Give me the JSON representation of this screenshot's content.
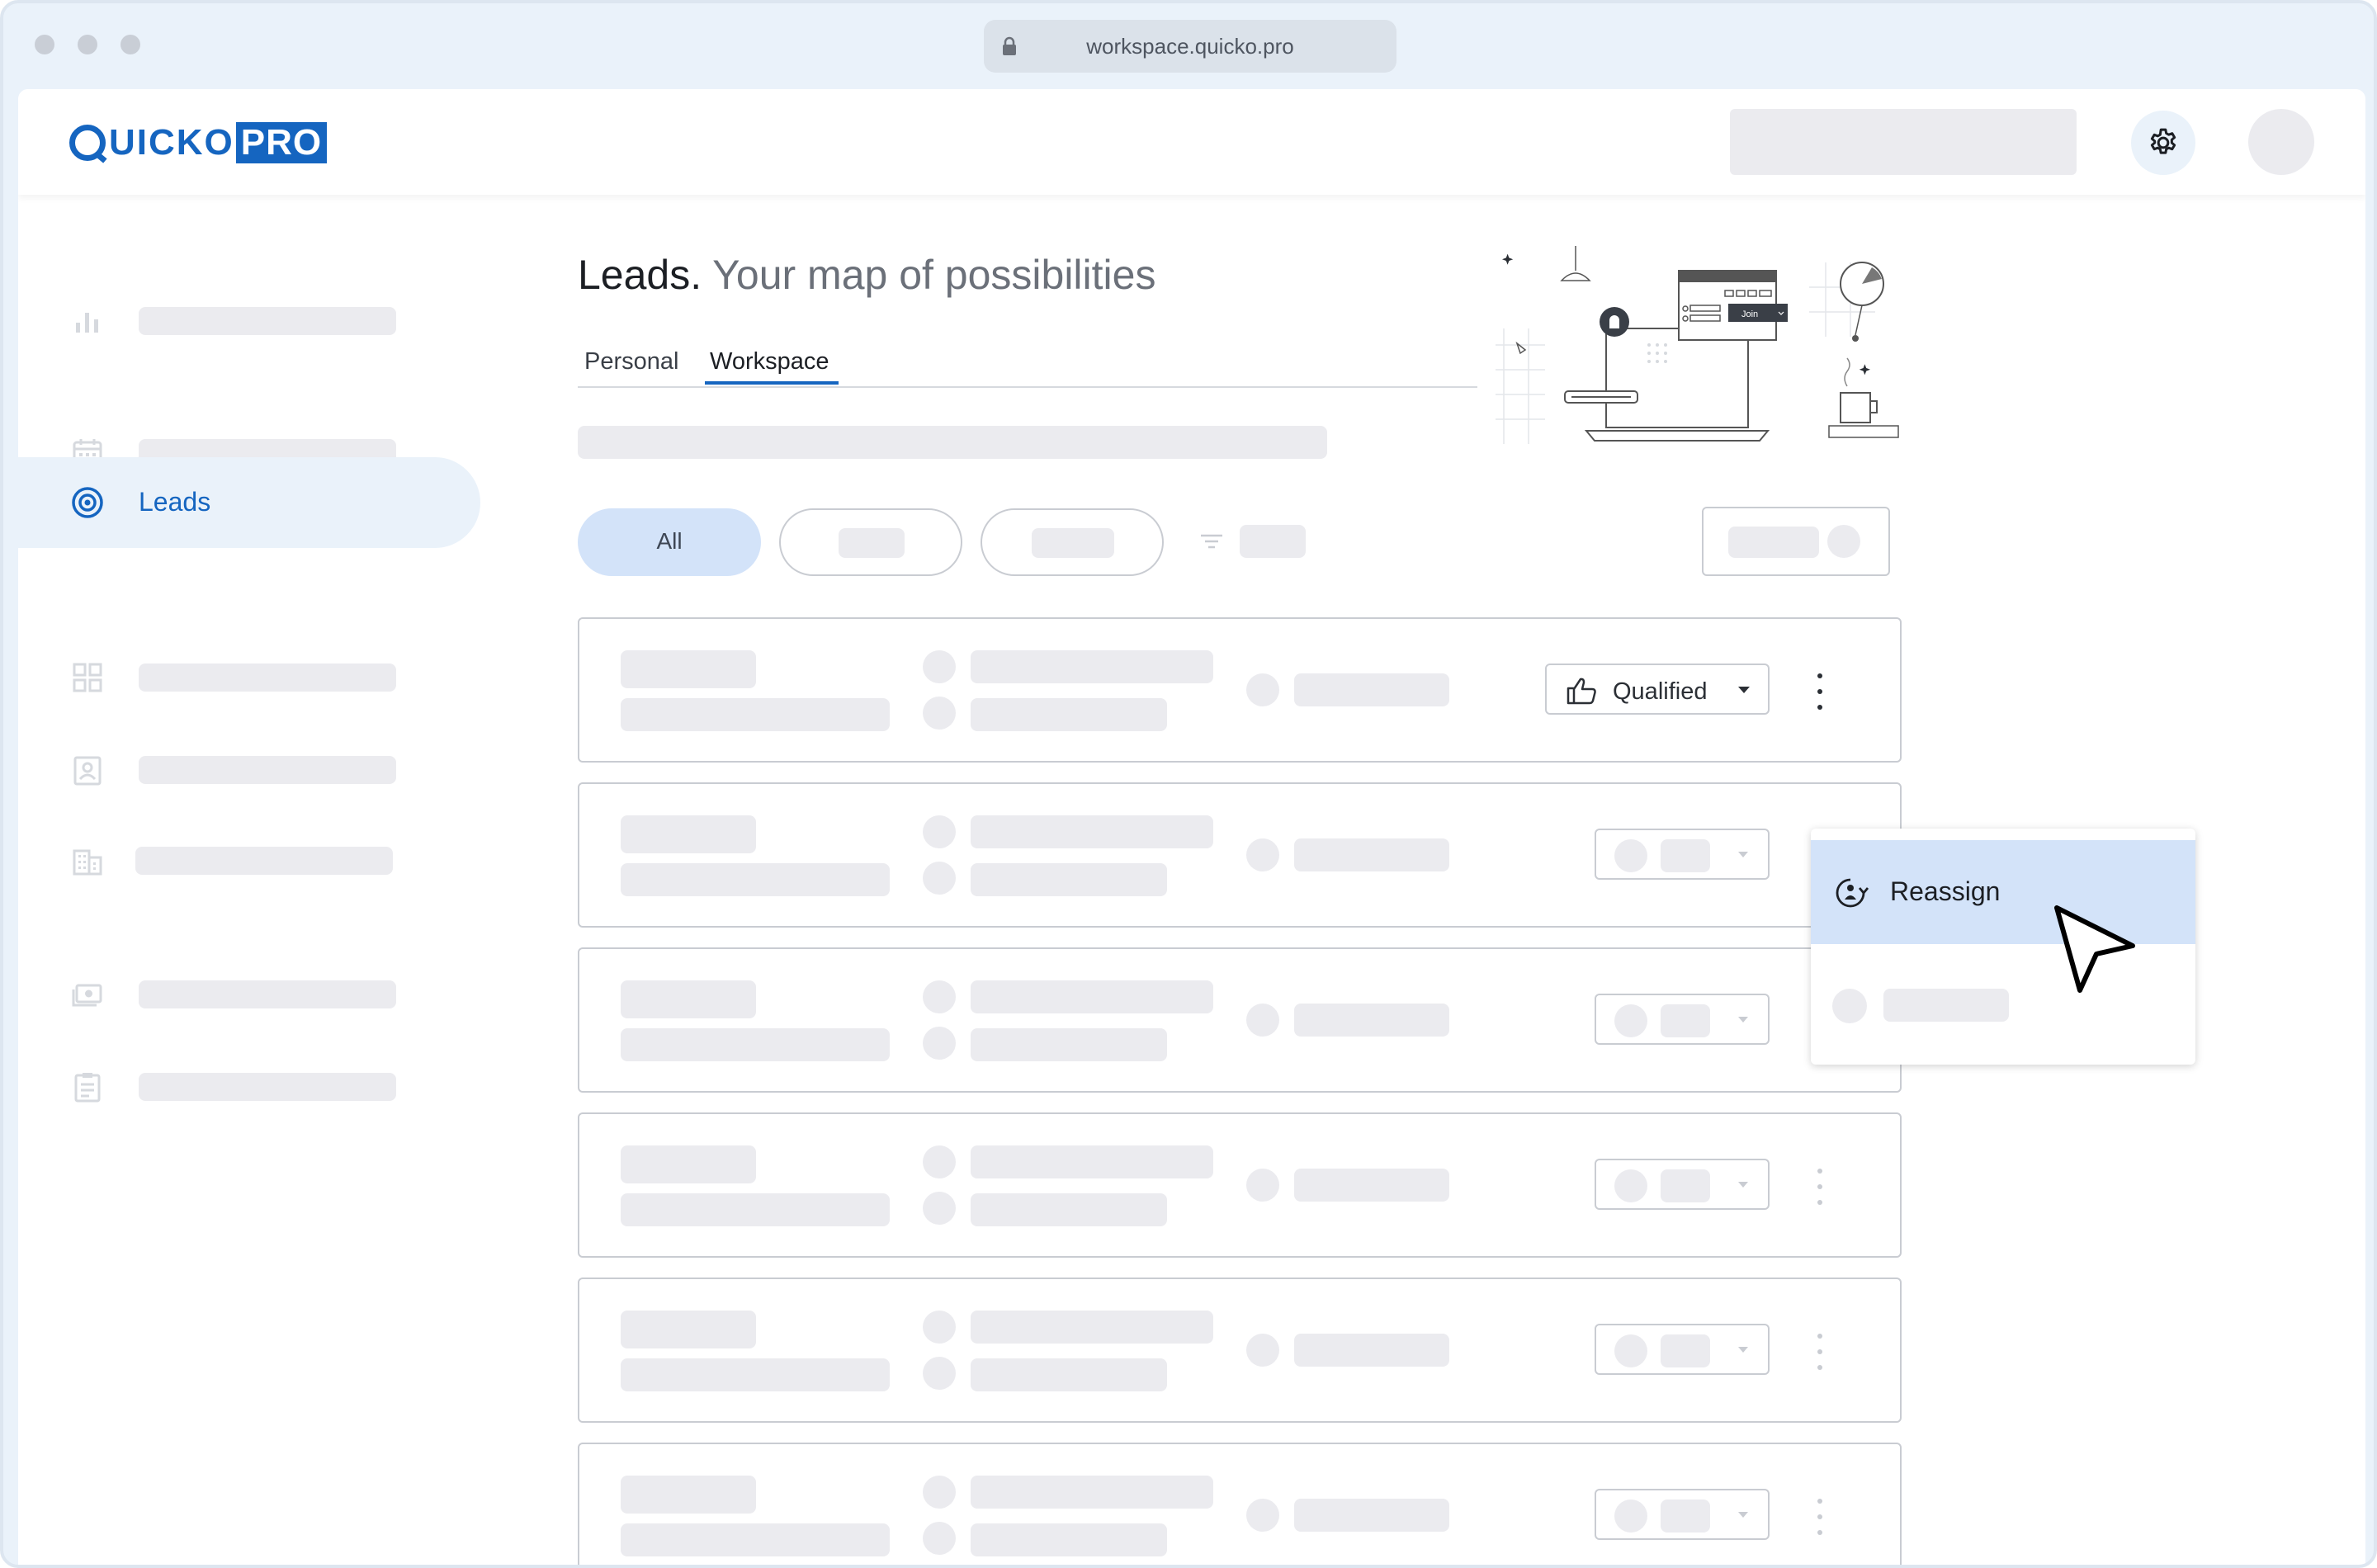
{
  "browser": {
    "url": "workspace.quicko.pro"
  },
  "brand": {
    "name_part": "UICKO",
    "name_suffix": "PRO",
    "accent_color": "#1565c0"
  },
  "sidebar": {
    "active_label": "Leads",
    "icons": [
      "bar-chart-icon",
      "calendar-icon",
      "target-icon",
      "grid-icon",
      "contact-card-icon",
      "building-icon",
      "money-icon",
      "clipboard-icon"
    ]
  },
  "page": {
    "title": "Leads.",
    "title_sub": "Your map of possibilities",
    "tabs": [
      "Personal",
      "Workspace"
    ],
    "active_tab": "Workspace"
  },
  "filters": {
    "all_label": "All"
  },
  "rows": {
    "first_status": "Qualified"
  },
  "menu": {
    "reassign_label": "Reassign"
  },
  "illustration": {
    "button_label": "Join"
  }
}
